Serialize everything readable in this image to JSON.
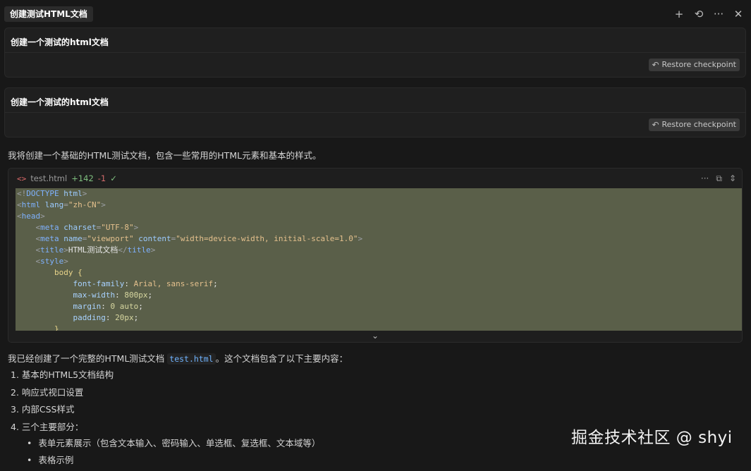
{
  "tab": {
    "title": "创建测试HTML文档"
  },
  "title_actions": {
    "plus": "+",
    "history": "⟲",
    "more": "···",
    "close": "✕"
  },
  "messages": [
    {
      "text": "创建一个测试的html文档",
      "restore_label": "Restore checkpoint"
    },
    {
      "text": "创建一个测试的html文档",
      "restore_label": "Restore checkpoint"
    }
  ],
  "intro": "我将创建一个基础的HTML测试文档，包含一些常用的HTML元素和基本的样式。",
  "code_block": {
    "file_icon": "<>",
    "filename": "test.html",
    "added": "+142",
    "removed": "-1",
    "check": "✓",
    "lines": [
      [
        {
          "t": "<!",
          "c": "t-punct"
        },
        {
          "t": "DOCTYPE",
          "c": "t-tag"
        },
        {
          "t": " html",
          "c": "t-attr"
        },
        {
          "t": ">",
          "c": "t-punct"
        }
      ],
      [
        {
          "t": "<",
          "c": "t-punct"
        },
        {
          "t": "html",
          "c": "t-tag"
        },
        {
          "t": " lang",
          "c": "t-attr"
        },
        {
          "t": "=",
          "c": "t-punct"
        },
        {
          "t": "\"zh-CN\"",
          "c": "t-str"
        },
        {
          "t": ">",
          "c": "t-punct"
        }
      ],
      [
        {
          "t": "<",
          "c": "t-punct"
        },
        {
          "t": "head",
          "c": "t-tag"
        },
        {
          "t": ">",
          "c": "t-punct"
        }
      ],
      [
        {
          "t": "    <",
          "c": "t-punct"
        },
        {
          "t": "meta",
          "c": "t-tag"
        },
        {
          "t": " charset",
          "c": "t-attr"
        },
        {
          "t": "=",
          "c": "t-punct"
        },
        {
          "t": "\"UTF-8\"",
          "c": "t-str"
        },
        {
          "t": ">",
          "c": "t-punct"
        }
      ],
      [
        {
          "t": "    <",
          "c": "t-punct"
        },
        {
          "t": "meta",
          "c": "t-tag"
        },
        {
          "t": " name",
          "c": "t-attr"
        },
        {
          "t": "=",
          "c": "t-punct"
        },
        {
          "t": "\"viewport\"",
          "c": "t-str"
        },
        {
          "t": " content",
          "c": "t-attr"
        },
        {
          "t": "=",
          "c": "t-punct"
        },
        {
          "t": "\"width=device-width, initial-scale=1.0\"",
          "c": "t-str"
        },
        {
          "t": ">",
          "c": "t-punct"
        }
      ],
      [
        {
          "t": "    <",
          "c": "t-punct"
        },
        {
          "t": "title",
          "c": "t-tag"
        },
        {
          "t": ">",
          "c": "t-punct"
        },
        {
          "t": "HTML测试文档",
          "c": "t-text"
        },
        {
          "t": "</",
          "c": "t-punct"
        },
        {
          "t": "title",
          "c": "t-tag"
        },
        {
          "t": ">",
          "c": "t-punct"
        }
      ],
      [
        {
          "t": "    <",
          "c": "t-punct"
        },
        {
          "t": "style",
          "c": "t-tag"
        },
        {
          "t": ">",
          "c": "t-punct"
        }
      ],
      [
        {
          "t": "        body",
          "c": "t-sel"
        },
        {
          "t": " {",
          "c": "t-bracket"
        }
      ],
      [
        {
          "t": "            font-family",
          "c": "t-prop"
        },
        {
          "t": ": ",
          "c": "t-text"
        },
        {
          "t": "Arial, sans-serif",
          "c": "t-val"
        },
        {
          "t": ";",
          "c": "t-text"
        }
      ],
      [
        {
          "t": "            max-width",
          "c": "t-prop"
        },
        {
          "t": ": ",
          "c": "t-text"
        },
        {
          "t": "800px",
          "c": "t-num"
        },
        {
          "t": ";",
          "c": "t-text"
        }
      ],
      [
        {
          "t": "            margin",
          "c": "t-prop"
        },
        {
          "t": ": ",
          "c": "t-text"
        },
        {
          "t": "0 auto",
          "c": "t-num"
        },
        {
          "t": ";",
          "c": "t-text"
        }
      ],
      [
        {
          "t": "            padding",
          "c": "t-prop"
        },
        {
          "t": ": ",
          "c": "t-text"
        },
        {
          "t": "20px",
          "c": "t-num"
        },
        {
          "t": ";",
          "c": "t-text"
        }
      ],
      [
        {
          "t": "        }",
          "c": "t-bracket"
        }
      ]
    ],
    "expand_icon": "⌄",
    "actions": {
      "more": "···",
      "copy": "⧉",
      "toggle": "⇕"
    }
  },
  "summary_parts": {
    "before": "我已经创建了一个完整的HTML测试文档 ",
    "file": "test.html",
    "after": "。这个文档包含了以下主要内容："
  },
  "list": [
    "1. 基本的HTML5文档结构",
    "2. 响应式视口设置",
    "3. 内部CSS样式",
    "4. 三个主要部分："
  ],
  "sub_list": [
    "表单元素展示（包含文本输入、密码输入、单选框、复选框、文本域等）",
    "表格示例"
  ],
  "watermark": "掘金技术社区 @ shyi"
}
